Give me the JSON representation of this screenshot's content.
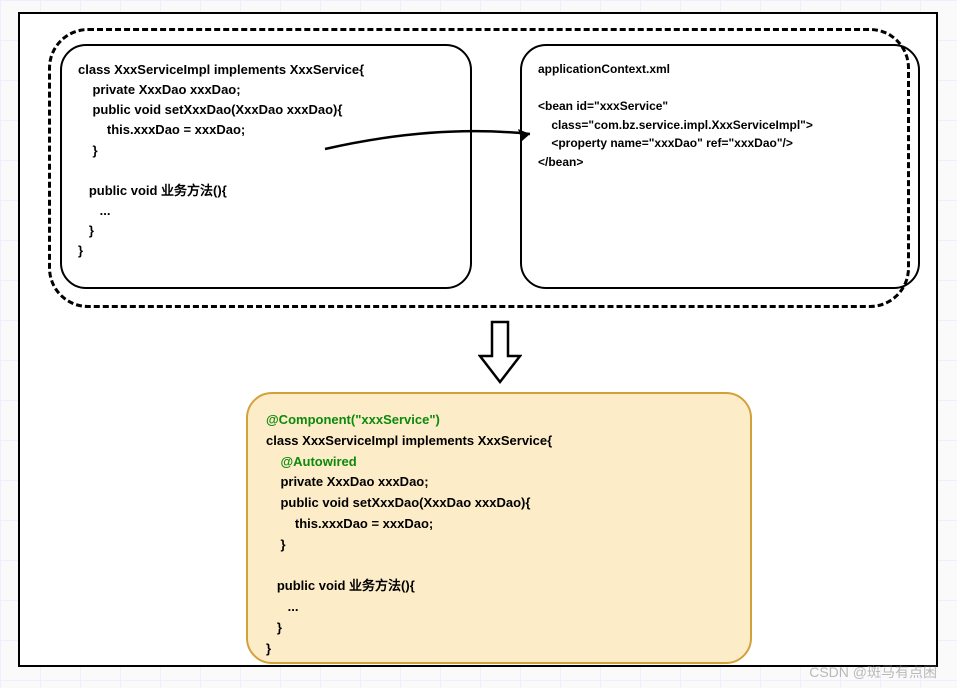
{
  "leftBox": {
    "line1": "class XxxServiceImpl implements XxxService{",
    "line2": "    private XxxDao xxxDao;",
    "line3": "    public void setXxxDao(XxxDao xxxDao){",
    "line4": "        this.xxxDao = xxxDao;",
    "line5": "    }",
    "line6": "",
    "line7": "   public void 业务方法(){",
    "line8": "      ...",
    "line9": "   }",
    "line10": "}"
  },
  "rightBox": {
    "line1": "applicationContext.xml",
    "line2": "",
    "line3": "<bean id=\"xxxService\"",
    "line4": "    class=\"com.bz.service.impl.XxxServiceImpl\">",
    "line5": "    <property name=\"xxxDao\" ref=\"xxxDao\"/>",
    "line6": "</bean>"
  },
  "bottomBox": {
    "line1": "@Component(\"xxxService\")",
    "line2": "class XxxServiceImpl implements XxxService{",
    "line3": "    @Autowired",
    "line4": "    private XxxDao xxxDao;",
    "line5": "    public void setXxxDao(XxxDao xxxDao){",
    "line6": "        this.xxxDao = xxxDao;",
    "line7": "    }",
    "line8": "",
    "line9": "   public void 业务方法(){",
    "line10": "      ...",
    "line11": "   }",
    "line12": "}"
  },
  "watermark": "CSDN @斑马有点困"
}
